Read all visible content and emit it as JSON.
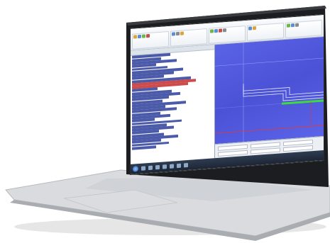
{
  "colors": {
    "viewport_background": "#4f57dc",
    "toolpath_white": "#e8eefc",
    "toolpath_green": "#3ddc3d",
    "toolpath_red": "#e23a3a",
    "code_text": "#2c3e9a",
    "code_highlight": "#c62b2b",
    "taskbar": "#1c2534"
  },
  "icons": {
    "start": "windows-start-icon",
    "taskbar_apps": [
      "folder-icon",
      "app-icon",
      "app-icon",
      "media-icon",
      "app-icon",
      "app-icon",
      "app-icon",
      "app-icon",
      "app-icon"
    ]
  }
}
